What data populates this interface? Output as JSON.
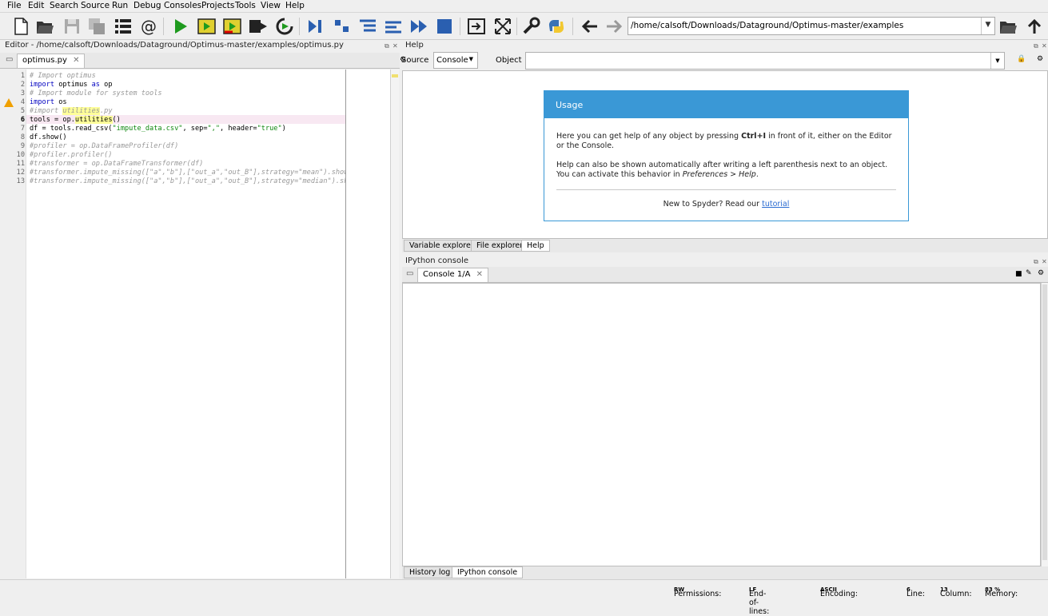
{
  "menu": [
    "File",
    "Edit",
    "Search",
    "Source",
    "Run",
    "Debug",
    "Consoles",
    "Projects",
    "Tools",
    "View",
    "Help"
  ],
  "toolbar": {
    "icons": [
      "new-file",
      "open-file",
      "save",
      "save-all",
      "browse-tabs",
      "email",
      "list",
      "run",
      "run-cell",
      "run-cell-advance",
      "run-selection",
      "rerun",
      "debug",
      "step",
      "step-into",
      "step-return",
      "continue",
      "stop",
      "maximize",
      "fullscreen",
      "preferences",
      "python-path",
      "back",
      "forward"
    ],
    "path": "/home/calsoft/Downloads/Dataground/Optimus-master/examples"
  },
  "editor": {
    "title": "Editor - /home/calsoft/Downloads/Dataground/Optimus-master/examples/optimus.py",
    "tab": "optimus.py",
    "line_numbers": [
      "1",
      "2",
      "3",
      "4",
      "5",
      "6",
      "7",
      "8",
      "9",
      "10",
      "11",
      "12",
      "13"
    ],
    "lines": {
      "l1": "# Import optimus",
      "l2a": "import",
      "l2b": " optimus ",
      "l2c": "as",
      "l2d": " op",
      "l3": "# Import module for system tools",
      "l4a": "import",
      "l4b": " os",
      "l5a": "#import ",
      "l5b": "utilities",
      "l5c": ".py",
      "l6a": "tools = op.",
      "l6b": "utilities",
      "l6c": "()",
      "l7a": "df = tools.read_csv(",
      "l7b": "\"impute_data.csv\"",
      "l7c": ", sep=",
      "l7d": "\",\"",
      "l7e": ", header=",
      "l7f": "\"true\"",
      "l7g": ")",
      "l8": "df.show()",
      "l9": "#profiler = op.DataFrameProfiler(df)",
      "l10": "#profiler.profiler()",
      "l11": "#transformer = op.DataFrameTransformer(df)",
      "l12": "#transformer.impute_missing([\"a\",\"b\"],[\"out_a\",\"out_B\"],strategy=\"mean\").show()",
      "l13": "#transformer.impute_missing([\"a\",\"b\"],[\"out_a\",\"out_B\"],strategy=\"median\").show()"
    }
  },
  "help": {
    "title": "Help",
    "source_label": "Source",
    "source_value": "Console",
    "object_label": "Object",
    "usage_title": "Usage",
    "p1a": "Here you can get help of any object by pressing ",
    "p1b": "Ctrl+I",
    "p1c": " in front of it, either on the Editor or the Console.",
    "p2a": "Help can also be shown automatically after writing a left parenthesis next to an object. You can activate this behavior in ",
    "p2b": "Preferences > Help",
    "p2c": ".",
    "p3a": "New to Spyder? Read our ",
    "p3b": "tutorial"
  },
  "top_tabs": [
    "Variable explorer",
    "File explorer",
    "Help"
  ],
  "console": {
    "title": "IPython console",
    "tab": "Console 1/A",
    "bottom_tabs": [
      "History log",
      "IPython console"
    ]
  },
  "status": {
    "permissions_label": "Permissions:",
    "permissions": "RW",
    "eol_label": "End-of-lines:",
    "eol": "LF",
    "encoding_label": "Encoding:",
    "encoding": "ASCII",
    "line_label": "Line:",
    "line": "6",
    "column_label": "Column:",
    "column": "13",
    "memory_label": "Memory:",
    "memory": "83 %"
  }
}
